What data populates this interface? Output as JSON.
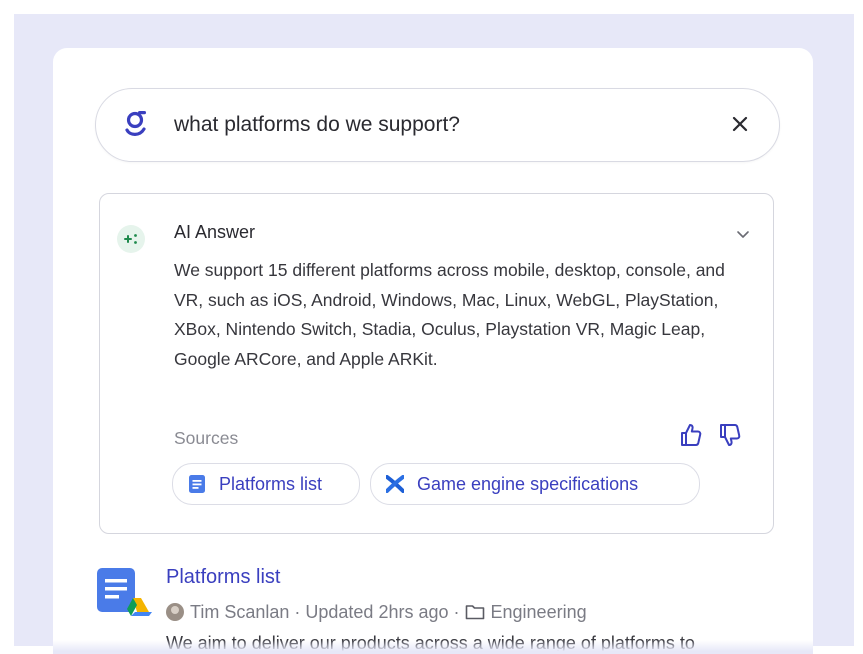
{
  "search": {
    "query": "what platforms do we support?",
    "logo_icon": "glean-logo-icon",
    "clear_icon": "close-icon"
  },
  "answer": {
    "title": "AI Answer",
    "body": "We support 15 different platforms across mobile, desktop, console, and VR, such as iOS, Android, Windows, Mac, Linux, WebGL, PlayStation, XBox, Nintendo Switch, Stadia, Oculus, Playstation VR, Magic Leap, Google ARCore, and Apple ARKit.",
    "sources_label": "Sources",
    "sources": [
      {
        "label": "Platforms list",
        "icon": "google-docs-icon"
      },
      {
        "label": "Game engine specifications",
        "icon": "confluence-icon"
      }
    ]
  },
  "result": {
    "title": "Platforms list",
    "author": "Tim Scanlan",
    "updated": "Updated 2hrs ago",
    "folder": "Engineering",
    "snippet": "We aim to deliver our products across a wide range of platforms to"
  },
  "colors": {
    "accent": "#3a3fbf",
    "background": "#e7e8f8",
    "sparkle_bg": "#e6f4ec",
    "sparkle": "#1e8a4c"
  }
}
